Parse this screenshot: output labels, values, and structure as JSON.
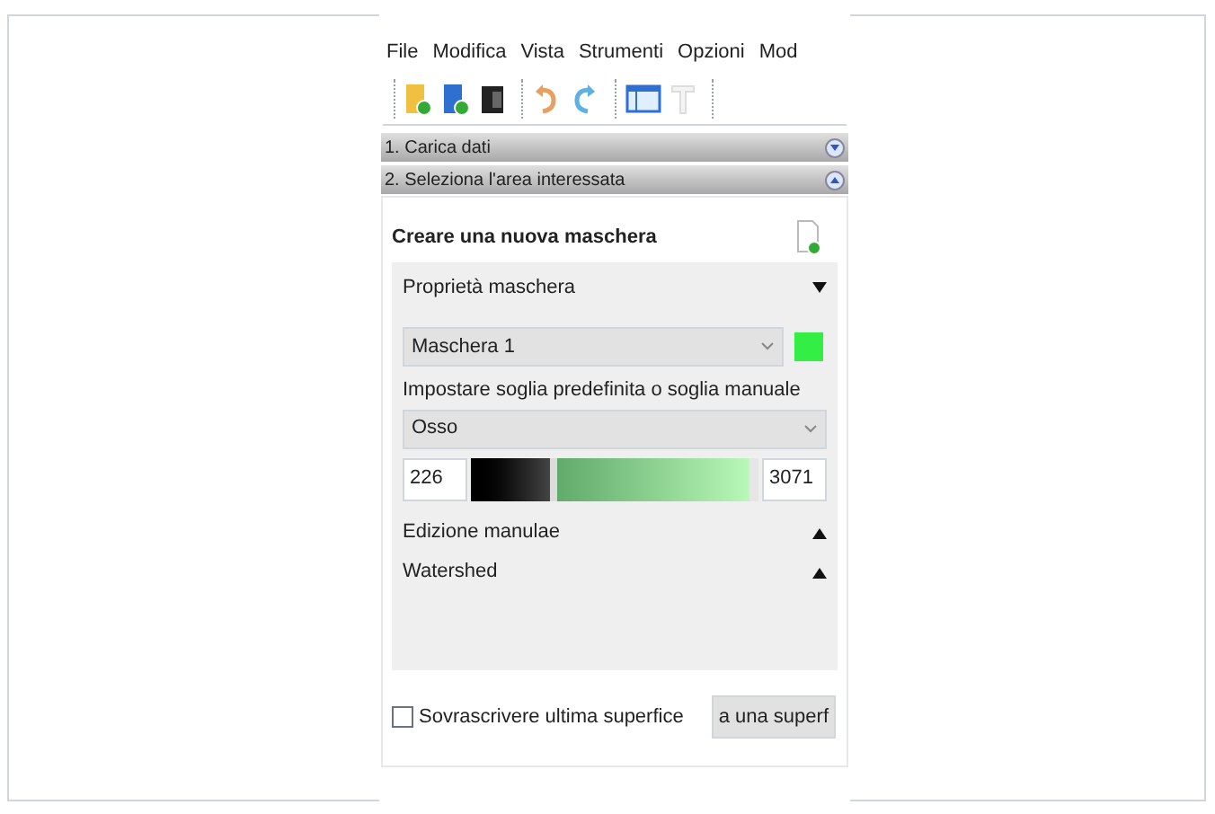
{
  "menu": [
    "File",
    "Modifica",
    "Vista",
    "Strumenti",
    "Opzioni",
    "Mod"
  ],
  "steps": [
    {
      "label": "1. Carica dati",
      "expanded": false
    },
    {
      "label": "2. Seleziona l'area interessata",
      "expanded": true
    }
  ],
  "panel": {
    "title": "Creare una nuova maschera",
    "properties": {
      "label": "Proprietà maschera",
      "expanded": true
    },
    "mask": {
      "value": "Maschera 1",
      "color": "#33ee44"
    },
    "threshold_label": "Impostare soglia predefinita o soglia manuale",
    "preset": {
      "value": "Osso"
    },
    "range": {
      "min": "226",
      "max": "3071",
      "lower": {
        "level": 0.3
      },
      "upper": {
        "level": 0.97
      }
    },
    "sections": [
      {
        "label": "Edizione manulae",
        "expanded": false
      },
      {
        "label": "Watershed",
        "expanded": false
      }
    ],
    "overwrite": {
      "label": "Sovrascrivere ultima superfice",
      "checked": false
    },
    "button": "a una superf"
  }
}
